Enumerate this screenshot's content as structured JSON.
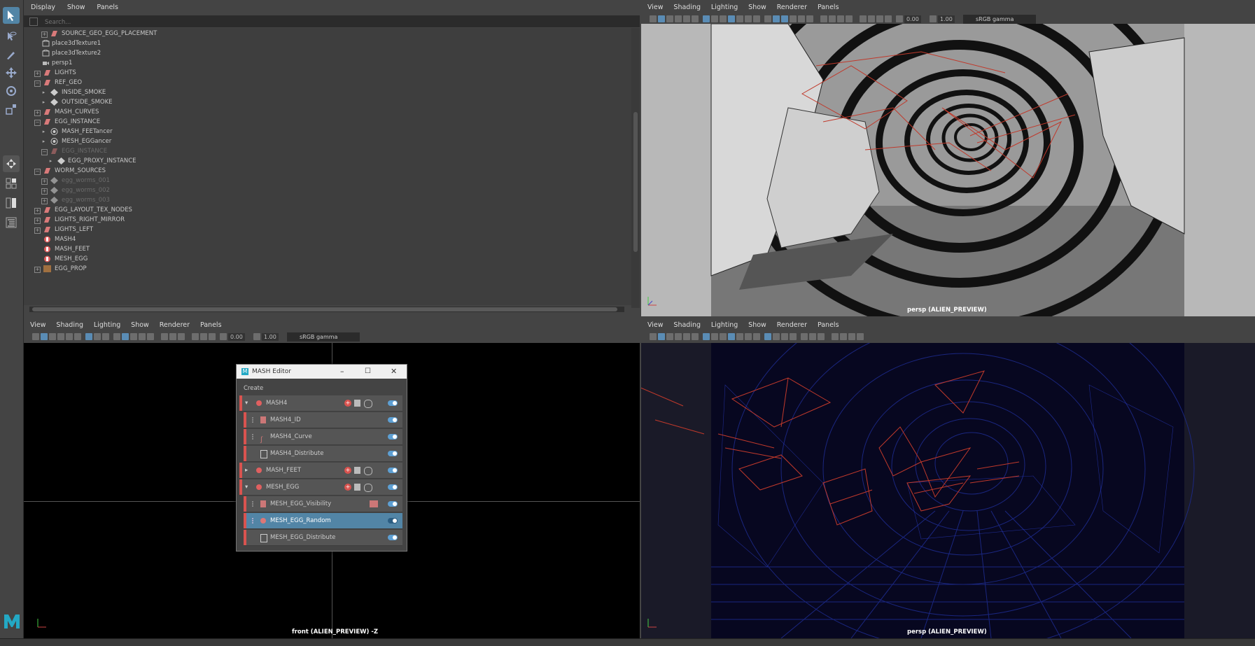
{
  "outliner": {
    "menu": [
      "Display",
      "Show",
      "Panels"
    ],
    "search_placeholder": "Search...",
    "items": [
      {
        "label": "SOURCE_GEO_EGG_PLACEMENT",
        "icon": "group-icon",
        "dim": false
      },
      {
        "label": "place3dTexture1",
        "icon": "texture-placement-icon",
        "dim": false
      },
      {
        "label": "place3dTexture2",
        "icon": "texture-placement-icon",
        "dim": false
      },
      {
        "label": "persp1",
        "icon": "camera-icon",
        "dim": false
      },
      {
        "label": "LIGHTS",
        "icon": "group-icon",
        "dim": false
      },
      {
        "label": "REF_GEO",
        "icon": "group-icon",
        "dim": false
      },
      {
        "label": "INSIDE_SMOKE",
        "icon": "volume-icon",
        "dim": false
      },
      {
        "label": "OUTSIDE_SMOKE",
        "icon": "volume-icon",
        "dim": false
      },
      {
        "label": "MASH_CURVES",
        "icon": "group-icon",
        "dim": false
      },
      {
        "label": "EGG_INSTANCE",
        "icon": "group-icon",
        "dim": false
      },
      {
        "label": "MASH_FEETancer",
        "icon": "instancer-icon",
        "dim": false
      },
      {
        "label": "MESH_EGGancer",
        "icon": "instancer-icon",
        "dim": false
      },
      {
        "label": "EGG_INSTANCE",
        "icon": "group-icon",
        "dim": true
      },
      {
        "label": "EGG_PROXY_INSTANCE",
        "icon": "volume-icon",
        "dim": false
      },
      {
        "label": "WORM_SOURCES",
        "icon": "group-icon",
        "dim": false
      },
      {
        "label": "egg_worms_001",
        "icon": "volume-icon",
        "dim": true
      },
      {
        "label": "egg_worms_002",
        "icon": "volume-icon",
        "dim": true
      },
      {
        "label": "egg_worms_003",
        "icon": "volume-icon",
        "dim": true
      },
      {
        "label": "EGG_LAYOUT_TEX_NODES",
        "icon": "group-icon",
        "dim": false
      },
      {
        "label": "LIGHTS_RIGHT_MIRROR",
        "icon": "group-icon",
        "dim": false
      },
      {
        "label": "LIGHTS_LEFT",
        "icon": "group-icon",
        "dim": false
      },
      {
        "label": "MASH4",
        "icon": "mash-icon",
        "dim": false
      },
      {
        "label": "MASH_FEET",
        "icon": "mash-icon",
        "dim": false
      },
      {
        "label": "MESH_EGG",
        "icon": "mash-icon",
        "dim": false
      },
      {
        "label": "EGG_PROP",
        "icon": "group-icon",
        "dim": false
      }
    ]
  },
  "viewports": {
    "top_right": {
      "menu": [
        "View",
        "Shading",
        "Lighting",
        "Show",
        "Renderer",
        "Panels"
      ],
      "exposure": "0.00",
      "gamma": "1.00",
      "colorspace": "sRGB gamma",
      "caption": "persp (ALIEN_PREVIEW)"
    },
    "bottom_left": {
      "menu": [
        "View",
        "Shading",
        "Lighting",
        "Show",
        "Renderer",
        "Panels"
      ],
      "exposure": "0.00",
      "gamma": "1.00",
      "colorspace": "sRGB gamma",
      "caption": "front (ALIEN_PREVIEW) -Z"
    },
    "bottom_right": {
      "menu": [
        "View",
        "Shading",
        "Lighting",
        "Show",
        "Renderer",
        "Panels"
      ],
      "caption": "persp (ALIEN_PREVIEW)"
    }
  },
  "mash_editor": {
    "title": "MASH Editor",
    "menu": "Create",
    "rows": [
      {
        "label": "MASH4",
        "level": 0,
        "expanded": true
      },
      {
        "label": "MASH4_ID",
        "level": 1
      },
      {
        "label": "MASH4_Curve",
        "level": 1
      },
      {
        "label": "MASH4_Distribute",
        "level": 1
      },
      {
        "label": "MASH_FEET",
        "level": 0,
        "expanded": false
      },
      {
        "label": "MESH_EGG",
        "level": 0,
        "expanded": true
      },
      {
        "label": "MESH_EGG_Visibility",
        "level": 1
      },
      {
        "label": "MESH_EGG_Random",
        "level": 1,
        "selected": true
      },
      {
        "label": "MESH_EGG_Distribute",
        "level": 1
      }
    ]
  },
  "colors": {
    "accent": "#5285a6",
    "mash_red": "#d9534f",
    "wireframe_blue": "#1a1f7a",
    "curve_red": "#c0392b"
  },
  "logo": "M"
}
